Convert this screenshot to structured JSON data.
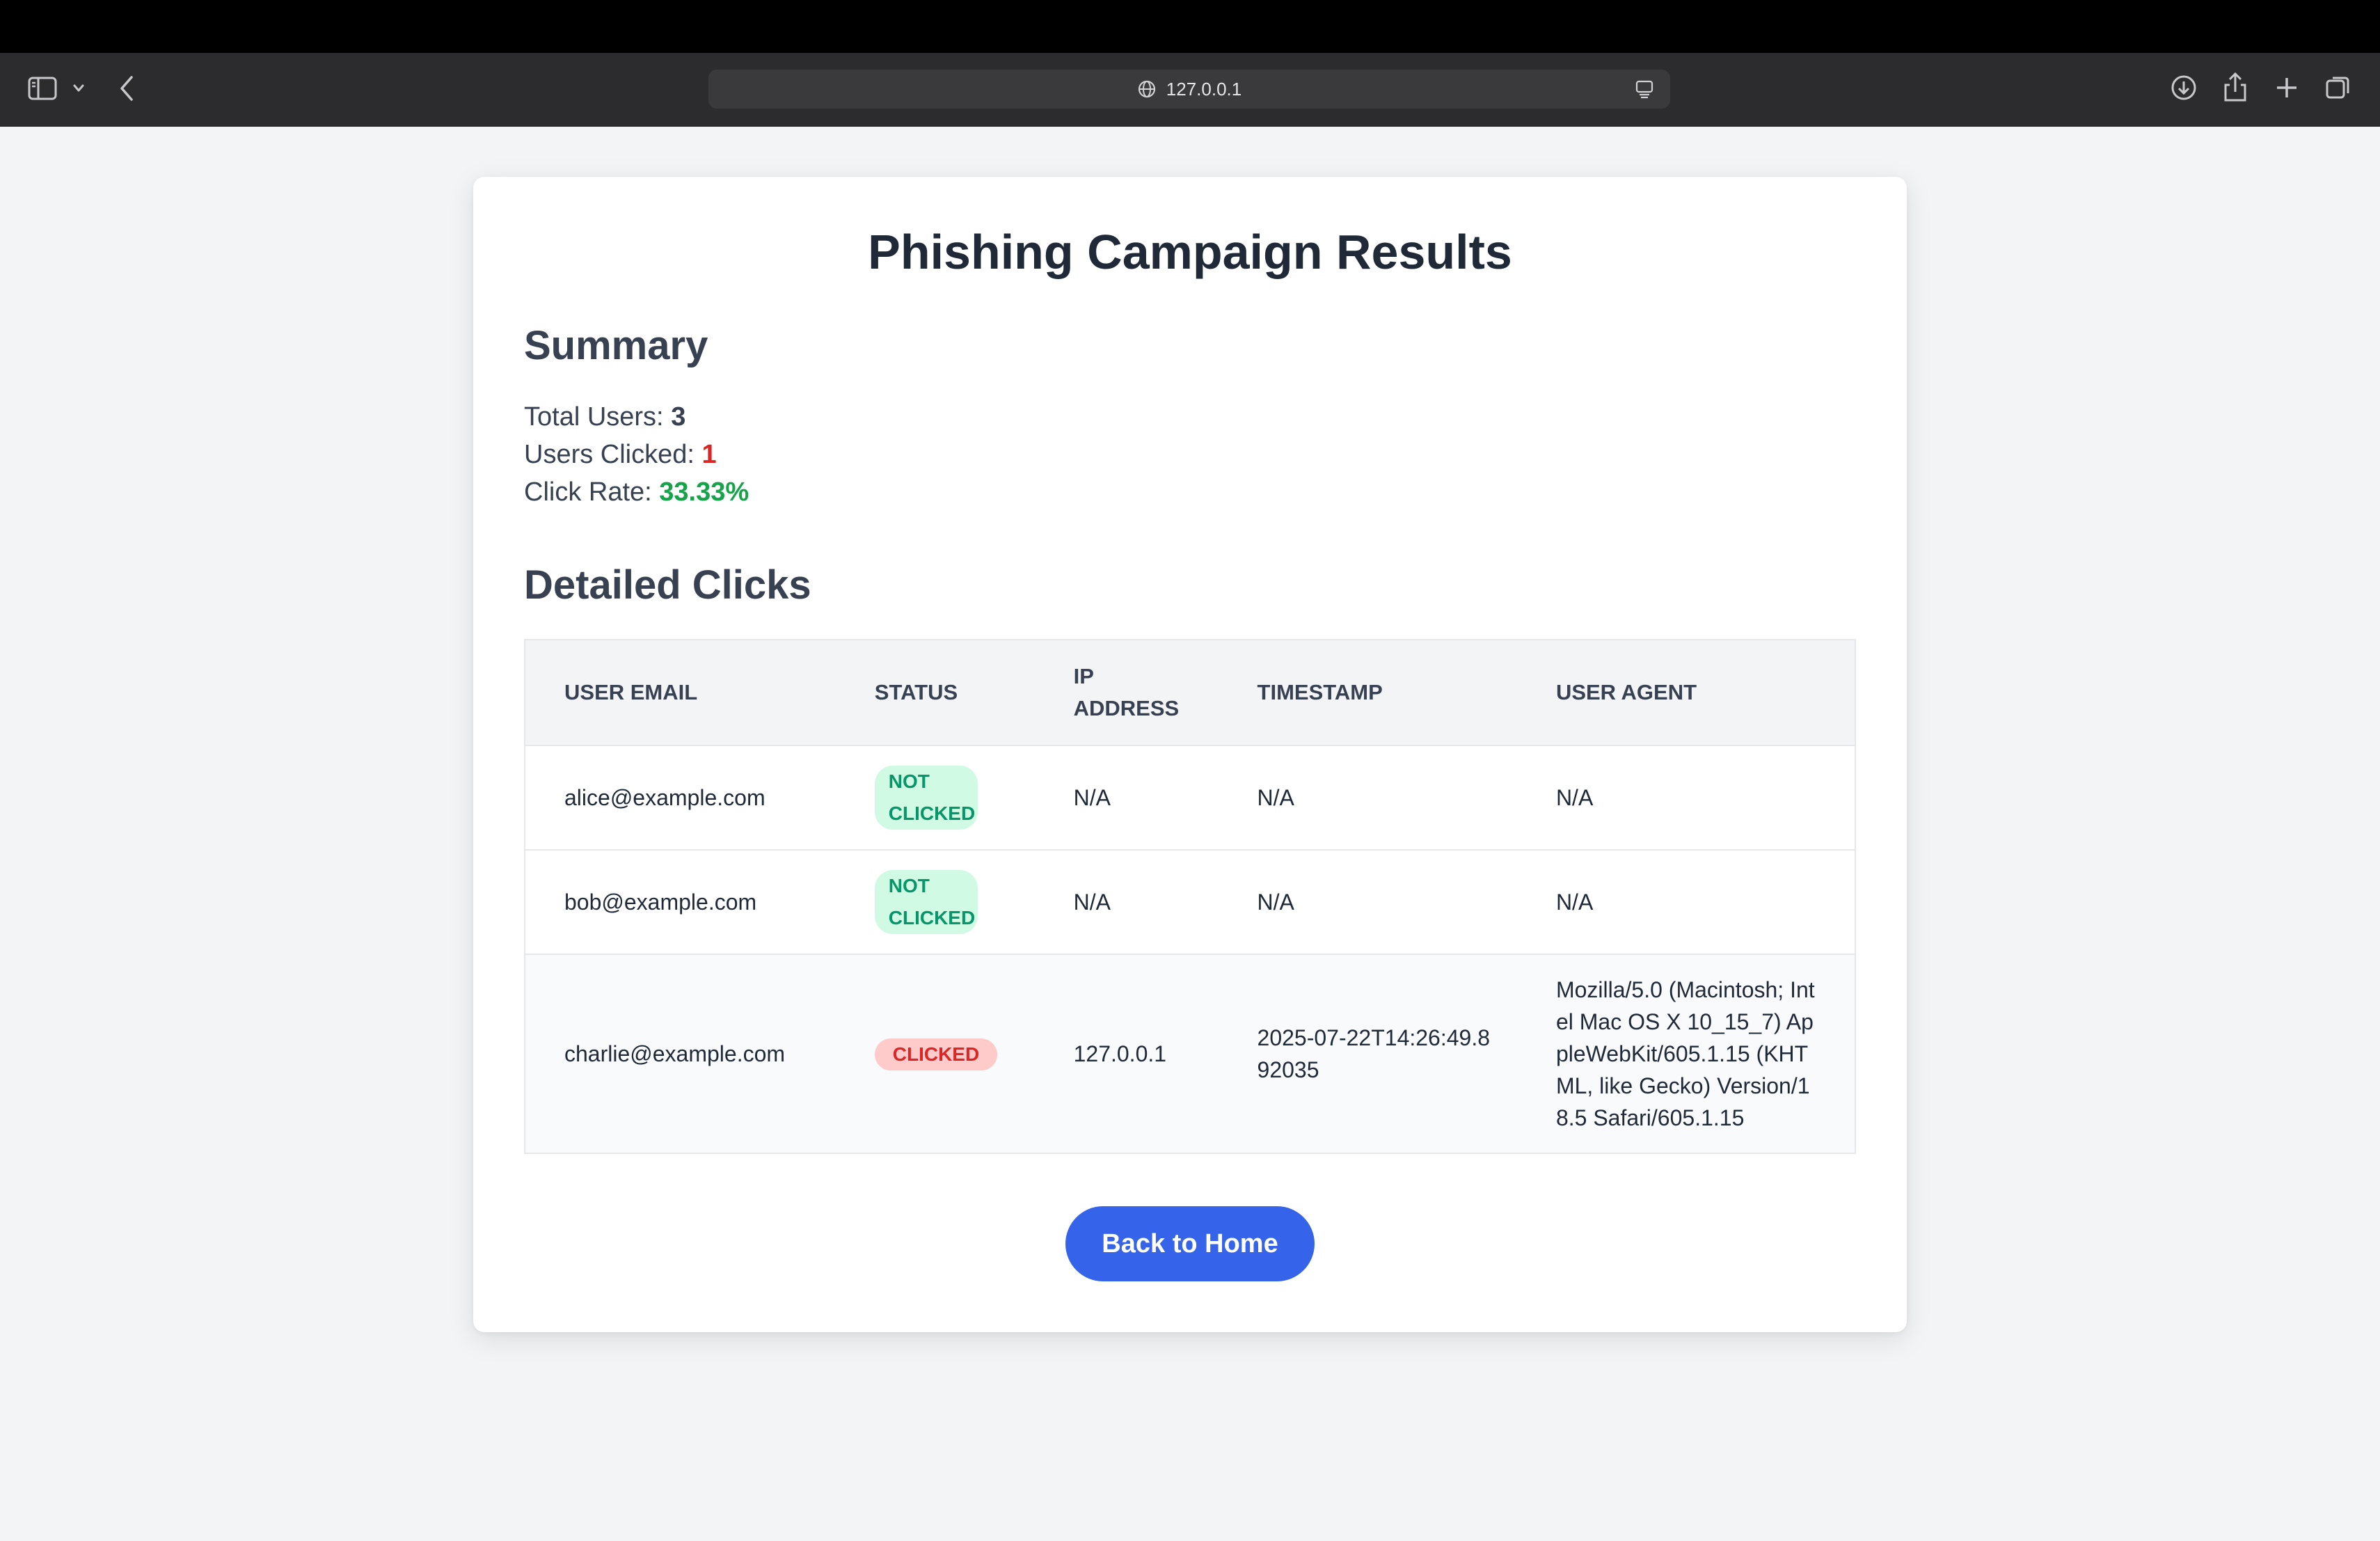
{
  "browser": {
    "url": "127.0.0.1"
  },
  "page": {
    "title": "Phishing Campaign Results",
    "summary": {
      "heading": "Summary",
      "total_users_label": "Total Users:",
      "total_users_value": "3",
      "users_clicked_label": "Users Clicked:",
      "users_clicked_value": "1",
      "click_rate_label": "Click Rate:",
      "click_rate_value": "33.33%"
    },
    "details": {
      "heading": "Detailed Clicks",
      "columns": [
        "USER EMAIL",
        "STATUS",
        "IP ADDRESS",
        "TIMESTAMP",
        "USER AGENT"
      ],
      "rows": [
        {
          "email": "alice@example.com",
          "status": "NOT CLICKED",
          "ip": "N/A",
          "timestamp": "N/A",
          "user_agent": "N/A"
        },
        {
          "email": "bob@example.com",
          "status": "NOT CLICKED",
          "ip": "N/A",
          "timestamp": "N/A",
          "user_agent": "N/A"
        },
        {
          "email": "charlie@example.com",
          "status": "CLICKED",
          "ip": "127.0.0.1",
          "timestamp": "2025-07-22T14:26:49.892035",
          "user_agent": "Mozilla/5.0 (Macintosh; Intel Mac OS X 10_15_7) AppleWebKit/605.1.15 (KHTML, like Gecko) Version/18.5 Safari/605.1.15"
        }
      ]
    },
    "back_button_label": "Back to Home"
  },
  "colors": {
    "accent": "#3563e9",
    "clicked_red": "#dc2626",
    "success_green": "#16a34a",
    "not_clicked_badge_bg": "#d1fae5",
    "clicked_badge_bg": "#fecaca"
  }
}
